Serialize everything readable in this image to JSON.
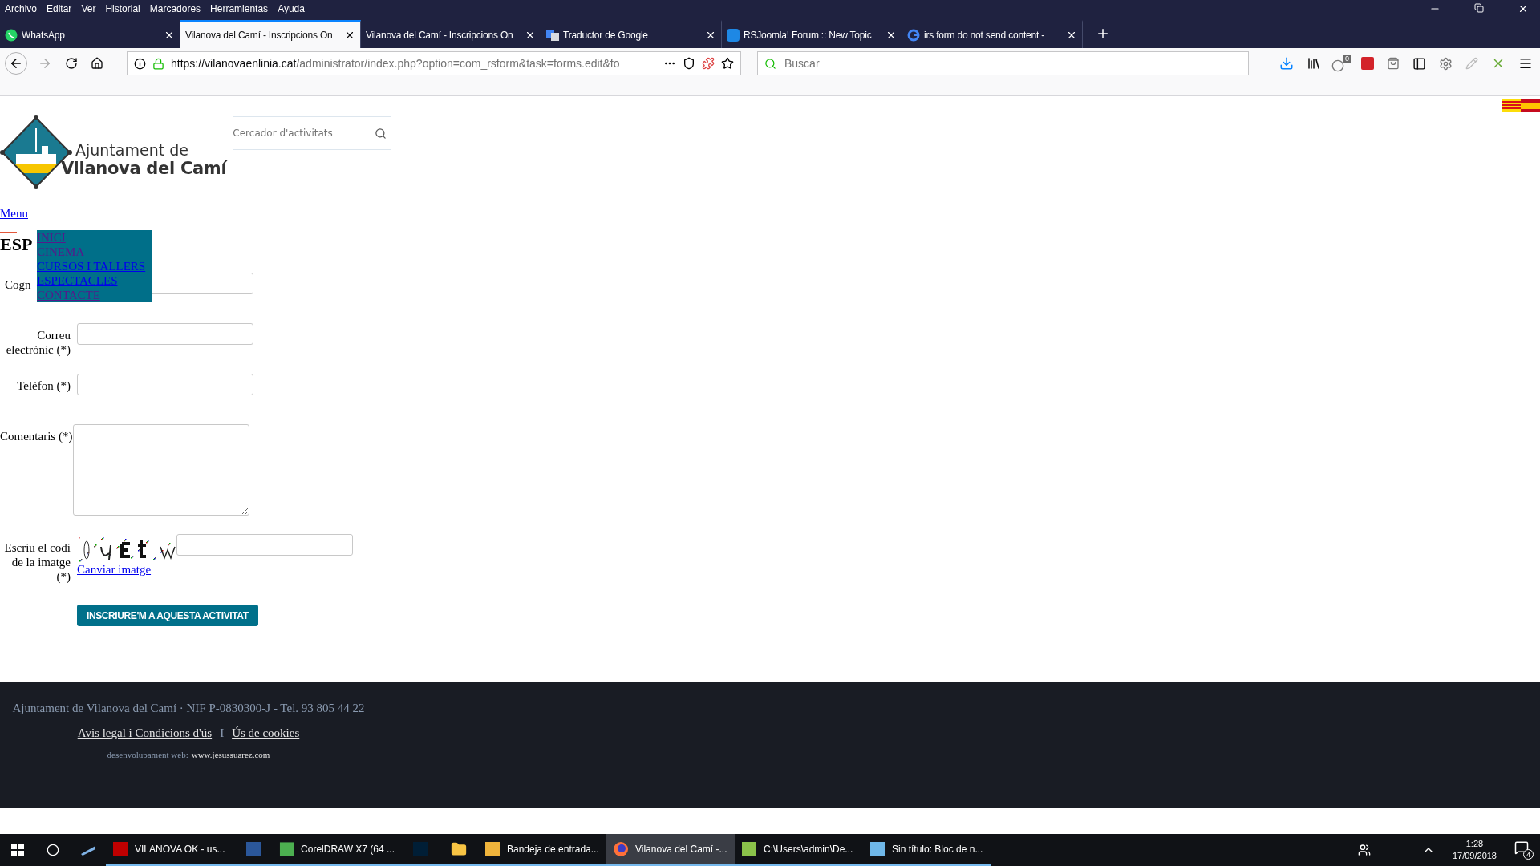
{
  "menu_bar": [
    "Archivo",
    "Editar",
    "Ver",
    "Historial",
    "Marcadores",
    "Herramientas",
    "Ayuda"
  ],
  "tabs": [
    {
      "title": "WhatsApp",
      "selected": false
    },
    {
      "title": "Vilanova del Camí - Inscripcions On",
      "selected": true
    },
    {
      "title": "Vilanova del Camí - Inscripcions On",
      "selected": false
    },
    {
      "title": "Traductor de Google",
      "selected": false
    },
    {
      "title": "RSJoomla! Forum :: New Topic",
      "selected": false
    },
    {
      "title": "irs form do not send content -",
      "selected": false
    }
  ],
  "address_bar": {
    "host": "https://vilanovaenlinia.cat",
    "path": "/administrator/index.php?option=com_rsform&task=forms.edit&fo"
  },
  "search_bar": {
    "placeholder": "Buscar"
  },
  "toolbar_badge": "0",
  "site": {
    "logo_line_1": "Ajuntament de",
    "logo_line_2": "Vilanova del Camí",
    "search": {
      "placeholder": "Cercador d'activitats"
    },
    "menu_link": "Menu",
    "heading": "ESP",
    "nav": [
      {
        "label": "INICI",
        "visited": true
      },
      {
        "label": "CINEMA",
        "visited": true
      },
      {
        "label": "CURSOS I TALLERS",
        "visited": false
      },
      {
        "label": "ESPECTACLES",
        "visited": false
      },
      {
        "label": "CONTACTE",
        "visited": true
      }
    ]
  },
  "form": {
    "fields": [
      {
        "label": "Cogn",
        "kind": "input"
      },
      {
        "label": "Correu electrònic (*)",
        "kind": "input"
      },
      {
        "label": "Telèfon (*)",
        "kind": "input"
      },
      {
        "label": "Comentaris (*)",
        "kind": "textarea"
      },
      {
        "label": "Escriu el codi de la imatge (*)",
        "kind": "captcha",
        "link": "Canviar imatge"
      }
    ],
    "submit": "INSCRIURE'M A AQUESTA ACTIVITAT"
  },
  "footer": {
    "info": "Ajuntament de Vilanova del Camí · NIF P-0830300-J - Tel. 93 805 44 22",
    "links": [
      "Avis legal i Condicions d'ús",
      "Ús de cookies"
    ],
    "separator": "I",
    "credit": "desenvolupament web:",
    "credit_link": "www.jesussuarez.com"
  },
  "taskbar": {
    "items": [
      {
        "label": "VILANOVA OK - us...",
        "selected": false
      },
      {
        "selected": false
      },
      {
        "label": "CorelDRAW X7 (64 ...",
        "selected": false
      },
      {
        "selected": false
      },
      {
        "selected": false
      },
      {
        "label": "Bandeja de entrada...",
        "selected": false
      },
      {
        "label": "Vilanova del Camí -...",
        "selected": true
      },
      {
        "label": "C:\\Users\\admin\\De...",
        "selected": false
      },
      {
        "label": "Sin título: Bloc de n...",
        "selected": false
      }
    ],
    "time": "1:28",
    "date": "17/09/2018",
    "notifications": "4"
  }
}
